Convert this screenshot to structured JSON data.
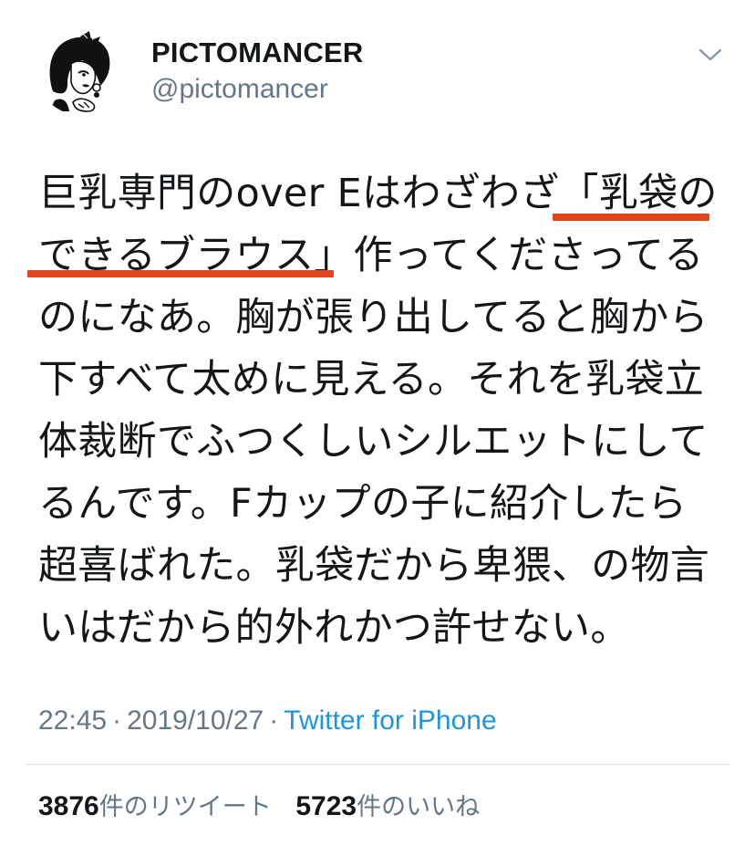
{
  "author": {
    "display_name": "PICTOMANCER",
    "handle": "@pictomancer",
    "avatar_icon": "illustrated-woman-avatar-icon"
  },
  "menu": {
    "icon": "chevron-down-icon"
  },
  "tweet": {
    "lines": [
      "巨乳専門のover Eはわざわざ「乳袋の",
      "できるブラウス」作ってくださってる",
      "のになあ。胸が張り出してると胸から",
      "下すべて太めに見える。それを乳袋立",
      "体裁断でふつくしいシルエットにして",
      "るんです。Fカップの子に紹介したら",
      "超喜ばれた。乳袋だから卑猥、の物言",
      "いはだから的外れかつ許せない。"
    ],
    "annotation_color": "#e2461e"
  },
  "meta": {
    "time": "22:45",
    "separator": "·",
    "date": "2019/10/27",
    "source": "Twitter for iPhone"
  },
  "stats": {
    "retweets": {
      "count": "3876",
      "label": "件のリツイート"
    },
    "likes": {
      "count": "5723",
      "label": "件のいいね"
    }
  },
  "colors": {
    "text": "#14171a",
    "secondary": "#657786",
    "link": "#1b95e0",
    "divider": "#d6dde3"
  }
}
